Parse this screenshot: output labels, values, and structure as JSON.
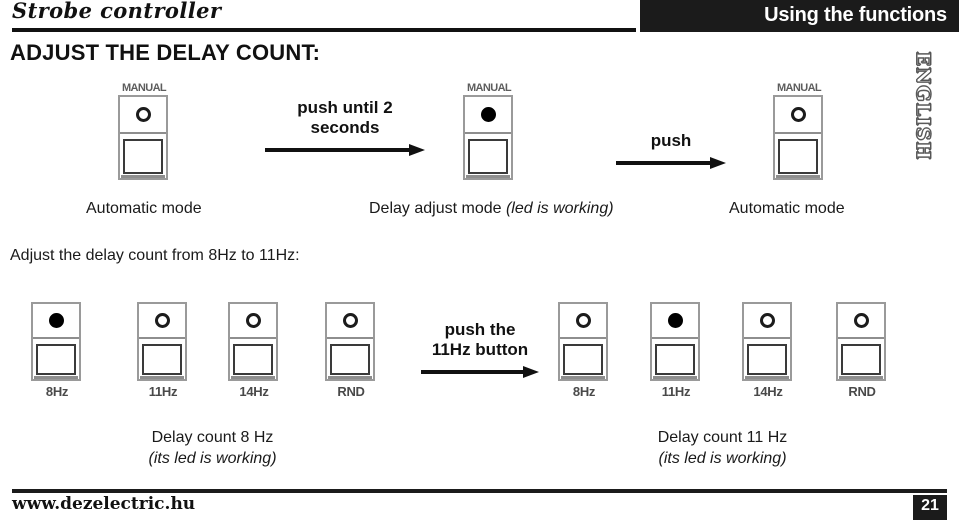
{
  "header": {
    "brand": "Strobe controller",
    "section_banner": "Using the functions",
    "language_tab": "ENGLISH"
  },
  "page_title": "ADJUST THE DELAY COUNT:",
  "top_sequence": {
    "devices": [
      {
        "brand": "MANUAL",
        "led": "off"
      },
      {
        "brand": "MANUAL",
        "led": "on"
      },
      {
        "brand": "MANUAL",
        "led": "off"
      }
    ],
    "annotations": [
      {
        "text": "push until 2\nseconds"
      },
      {
        "text": "push"
      }
    ],
    "captions": [
      {
        "plain": "Automatic mode",
        "italic": ""
      },
      {
        "plain": "Delay adjust mode ",
        "italic": "(led is working)"
      },
      {
        "plain": "Automatic mode",
        "italic": ""
      }
    ]
  },
  "instruction_line": "Adjust the delay count from 8Hz to 11Hz:",
  "bottom_sequence": {
    "left_group": {
      "devices": [
        {
          "caption": "8Hz",
          "led": "on"
        },
        {
          "caption": "11Hz",
          "led": "off"
        },
        {
          "caption": "14Hz",
          "led": "off"
        },
        {
          "caption": "RND",
          "led": "off"
        }
      ],
      "result": {
        "line1": "Delay count 8 Hz",
        "line2": "(its led is working)"
      }
    },
    "annotation": {
      "text": "push the\n11Hz button"
    },
    "right_group": {
      "devices": [
        {
          "caption": "8Hz",
          "led": "off"
        },
        {
          "caption": "11Hz",
          "led": "on"
        },
        {
          "caption": "14Hz",
          "led": "off"
        },
        {
          "caption": "RND",
          "led": "off"
        }
      ],
      "result": {
        "line1": "Delay count 11 Hz",
        "line2": "(its led is working)"
      }
    }
  },
  "footer": {
    "url": "www.dezelectric.hu",
    "page_number": "21"
  },
  "colors": {
    "ink": "#111111",
    "banner_bg": "#1b1b1b",
    "device_outline": "#9a9a9a"
  }
}
